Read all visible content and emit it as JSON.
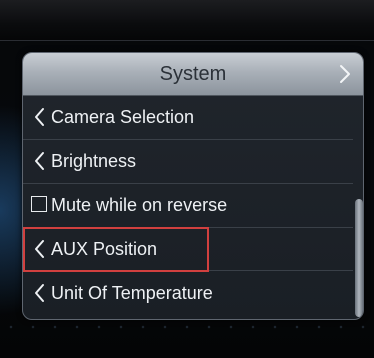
{
  "header": {
    "title": "System"
  },
  "list": {
    "items": [
      {
        "label": "Camera Selection",
        "type": "submenu"
      },
      {
        "label": "Brightness",
        "type": "submenu"
      },
      {
        "label": "Mute while on reverse",
        "type": "checkbox",
        "checked": false
      },
      {
        "label": "AUX Position",
        "type": "submenu",
        "highlighted": true
      },
      {
        "label": "Unit Of Temperature",
        "type": "submenu"
      }
    ]
  },
  "colors": {
    "header_bg": "#b4bbc3",
    "panel_bg": "#1d2228",
    "text": "#eef1f4",
    "highlight": "#d1403f"
  },
  "icons": {
    "submenu": "chevron-left-icon",
    "header_forward": "chevron-right-icon"
  }
}
